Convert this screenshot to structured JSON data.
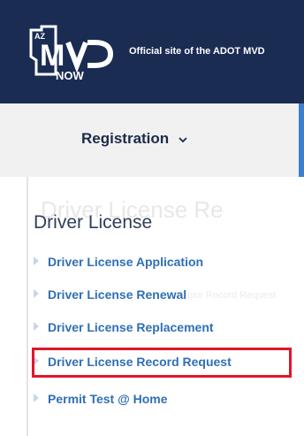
{
  "header": {
    "logo_state": "AZ",
    "logo_text": "MVD",
    "logo_sub": "NOW",
    "tagline": "Official site of the ADOT MVD"
  },
  "nav": {
    "registration_label": "Registration",
    "registration_icon": "chevron-down-icon"
  },
  "dropdown": {
    "ghost_title": "Driver License Re",
    "ghost_sub": "nse Record Request",
    "section_title": "Driver License",
    "items": [
      {
        "label": "Driver License Application"
      },
      {
        "label": "Driver License Renewal"
      },
      {
        "label": "Driver License Replacement"
      },
      {
        "label": "Driver License Record Request",
        "highlighted": true
      },
      {
        "label": "Permit Test @ Home"
      }
    ]
  },
  "colors": {
    "header_bg": "#1a2c52",
    "nav_bg": "#f1f1f1",
    "link": "#2f6fb6",
    "highlight": "#e0162b",
    "accent": "#3b7fd0"
  }
}
